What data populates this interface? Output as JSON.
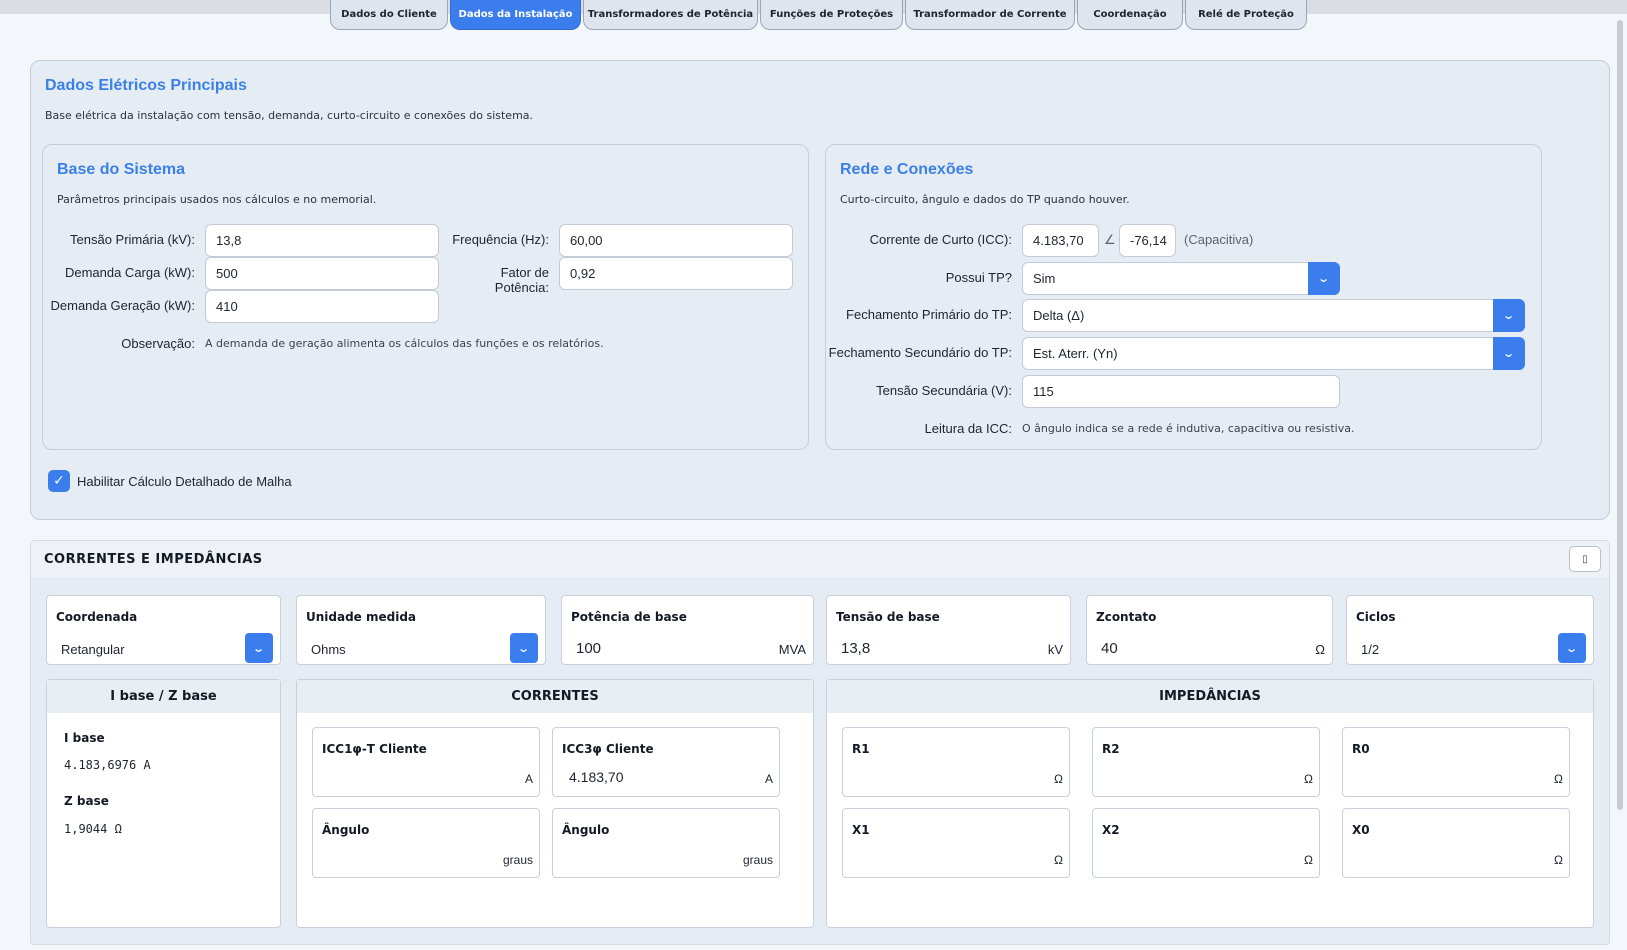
{
  "tabs": [
    {
      "label": "Dados do Cliente",
      "active": false
    },
    {
      "label": "Dados da Instalação",
      "active": true
    },
    {
      "label": "Transformadores de Potência",
      "active": false
    },
    {
      "label": "Funções de Proteções",
      "active": false
    },
    {
      "label": "Transformador de Corrente",
      "active": false
    },
    {
      "label": "Coordenação",
      "active": false
    },
    {
      "label": "Relé de Proteção",
      "active": false
    }
  ],
  "main": {
    "title": "Dados Elétricos Principais",
    "description": "Base elétrica da instalação com tensão, demanda, curto-circuito e conexões do sistema.",
    "base": {
      "title": "Base do Sistema",
      "description": "Parâmetros principais usados nos cálculos e no memorial.",
      "tensao_primaria_label": "Tensão Primária (kV):",
      "tensao_primaria_value": "13,8",
      "frequencia_label": "Frequência (Hz):",
      "frequencia_value": "60,00",
      "demanda_carga_label": "Demanda Carga (kW):",
      "demanda_carga_value": "500",
      "fator_potencia_label": "Fator de Potência:",
      "fator_potencia_value": "0,92",
      "demanda_geracao_label": "Demanda Geração (kW):",
      "demanda_geracao_value": "410",
      "observacao_label": "Observação:",
      "observacao_text": "A demanda de geração alimenta os cálculos das funções e os relatórios."
    },
    "rede": {
      "title": "Rede e Conexões",
      "description": "Curto-circuito, ângulo e dados do TP quando houver.",
      "icc_label": "Corrente de Curto (ICC):",
      "icc_value": "4.183,70",
      "angle_symbol": "∠",
      "icc_angle": "-76,14",
      "icc_type": "(Capacitiva)",
      "possui_tp_label": "Possui TP?",
      "possui_tp_value": "Sim",
      "fech_prim_label": "Fechamento Primário do TP:",
      "fech_prim_value": "Delta (Δ)",
      "fech_sec_label": "Fechamento Secundário do TP:",
      "fech_sec_value": "Est. Aterr. (Yn)",
      "tensao_sec_label": "Tensão Secundária (V):",
      "tensao_sec_value": "115",
      "leitura_label": "Leitura da ICC:",
      "leitura_text": "O ângulo indica se a rede é indutiva, capacitiva ou resistiva."
    },
    "checkbox_label": "Habilitar Cálculo Detalhado de Malha",
    "checkbox_checked": true
  },
  "correntes": {
    "title": "CORRENTES E IMPEDÂNCIAS",
    "toolbar_icon": "clipboard-icon",
    "coordenada_label": "Coordenada",
    "coordenada_value": "Retangular",
    "unidade_label": "Unidade medida",
    "unidade_value": "Ohms",
    "potencia_label": "Potência de base",
    "potencia_value": "100",
    "potencia_unit": "MVA",
    "tensao_label": "Tensão de base",
    "tensao_value": "13,8",
    "tensao_unit": "kV",
    "zcontato_label": "Zcontato",
    "zcontato_value": "40",
    "zcontato_unit": "Ω",
    "ciclos_label": "Ciclos",
    "ciclos_value": "1/2",
    "ibase_group_title": "I base / Z base",
    "ibase_label": "I base",
    "ibase_value": "4.183,6976 A",
    "zbase_label": "Z base",
    "zbase_value": "1,9044 Ω",
    "correntes_title": "CORRENTES",
    "icc1_label": "ICC1φ-T Cliente",
    "icc1_value": "",
    "icc1_unit": "A",
    "icc3_label": "ICC3φ Cliente",
    "icc3_value": "4.183,70",
    "icc3_unit": "A",
    "ang1_label": "Ângulo",
    "ang1_unit": "graus",
    "ang3_label": "Ângulo",
    "ang3_unit": "graus",
    "impedancias_title": "IMPEDÂNCIAS",
    "r1_label": "R1",
    "r2_label": "R2",
    "r0_label": "R0",
    "x1_label": "X1",
    "x2_label": "X2",
    "x0_label": "X0",
    "imp_unit": "Ω"
  }
}
